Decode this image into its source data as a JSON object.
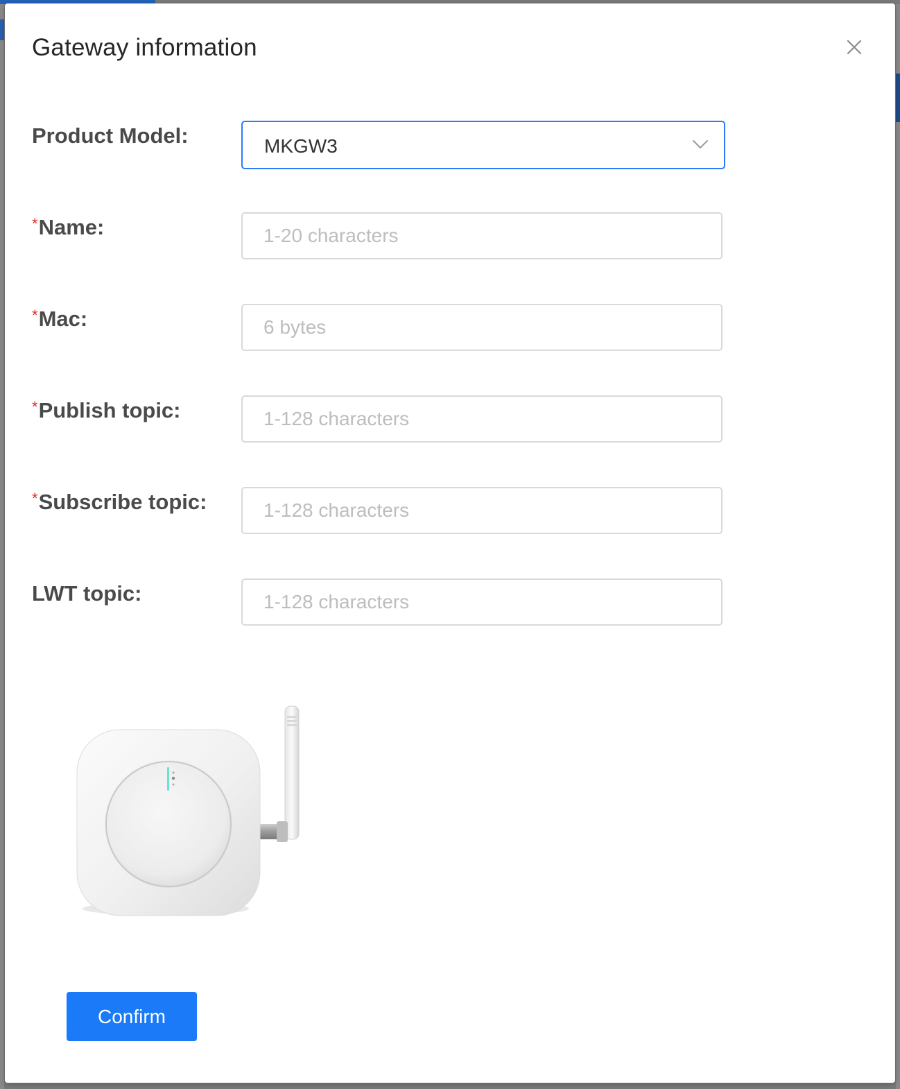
{
  "modal": {
    "title": "Gateway information",
    "close_icon": "close-icon"
  },
  "form": {
    "product_model": {
      "label": "Product Model:",
      "required": false,
      "value": "MKGW3"
    },
    "name": {
      "label": "Name:",
      "required": true,
      "placeholder": "1-20 characters",
      "value": ""
    },
    "mac": {
      "label": "Mac:",
      "required": true,
      "placeholder": "6 bytes",
      "value": ""
    },
    "publish_topic": {
      "label": "Publish topic:",
      "required": true,
      "placeholder": "1-128 characters",
      "value": ""
    },
    "subscribe_topic": {
      "label": "Subscribe topic:",
      "required": true,
      "placeholder": "1-128 characters",
      "value": ""
    },
    "lwt_topic": {
      "label": "LWT topic:",
      "required": false,
      "placeholder": "1-128 characters",
      "value": ""
    },
    "required_mark": "*"
  },
  "device_image": {
    "icon": "gateway-device-image"
  },
  "actions": {
    "confirm_label": "Confirm"
  },
  "colors": {
    "primary": "#1a7af8",
    "required": "#e52929",
    "select_border": "#2b7cf6",
    "input_border": "#d9d9d9"
  }
}
